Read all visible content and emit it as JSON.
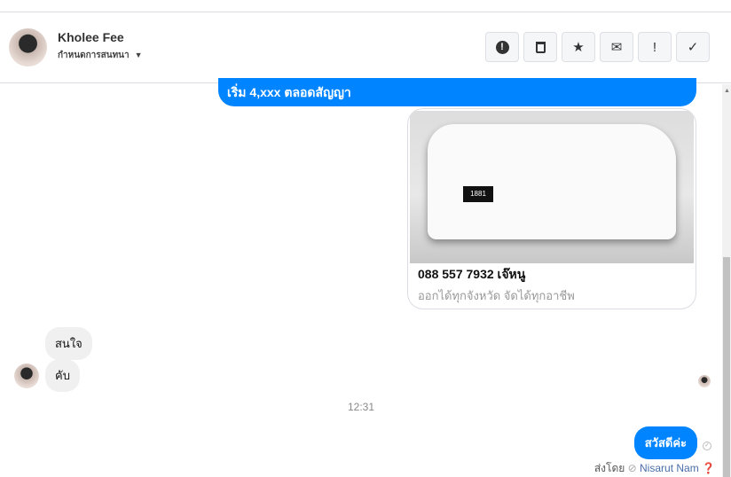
{
  "header": {
    "name": "Kholee Fee",
    "subtitle": "กำหนดการสนทนา"
  },
  "actions": [
    {
      "icon": "alert-circle-icon",
      "glyph": "⬤"
    },
    {
      "icon": "trash-icon",
      "glyph": "🗑"
    },
    {
      "icon": "star-icon",
      "glyph": "★"
    },
    {
      "icon": "envelope-icon",
      "glyph": "✉"
    },
    {
      "icon": "exclamation-icon",
      "glyph": "!"
    },
    {
      "icon": "check-icon",
      "glyph": "✓"
    }
  ],
  "messages": {
    "top_bubble": "เริ่ม 4,xxx ตลอดสัญญา",
    "card": {
      "plate": "1881",
      "title": "088 557 7932 เจ๊หนู",
      "subtitle": "ออกได้ทุกจังหวัด จัดได้ทุกอาชีพ"
    },
    "incoming": [
      "สนใจ",
      "คับ"
    ],
    "time": "12:31",
    "outgoing": "สวัสดีค่ะ",
    "sent_by_label": "ส่งโดย",
    "sent_by_name": "Nisarut Nam"
  }
}
